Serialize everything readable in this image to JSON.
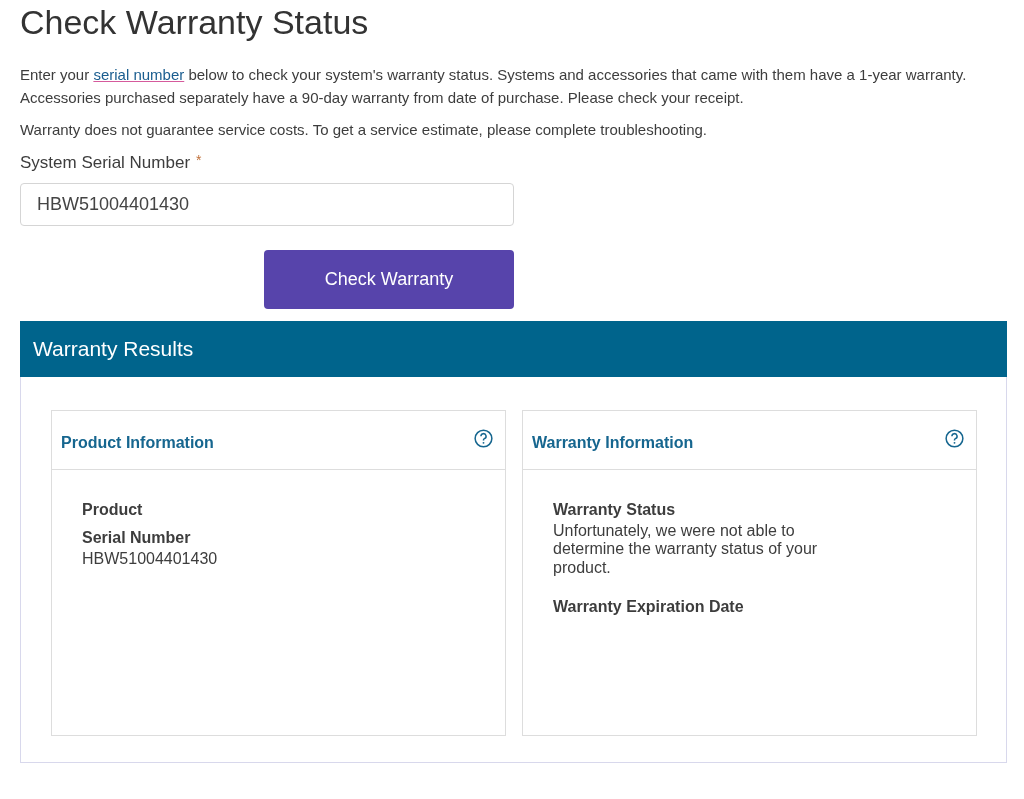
{
  "page_title": "Check Warranty Status",
  "intro": {
    "before": "Enter your ",
    "link": "serial number",
    "after": " below to check your system's warranty status. Systems and accessories that came with them have a 1-year warranty. Accessories purchased separately have a 90-day warranty from date of purchase. Please check your receipt."
  },
  "note": "Warranty does not guarantee service costs. To get a service estimate, please complete troubleshooting.",
  "serial_field": {
    "label": "System Serial Number",
    "required_mark": "*",
    "value": "HBW51004401430"
  },
  "submit_button": "Check Warranty",
  "results": {
    "title": "Warranty Results",
    "panels": [
      {
        "title": "Product Information",
        "fields": [
          {
            "label": "Product"
          },
          {
            "label": "Serial Number",
            "value": "HBW51004401430"
          }
        ]
      },
      {
        "title": "Warranty Information",
        "fields": [
          {
            "label": "Warranty Status",
            "value": "Unfortunately, we were not able to determine the warranty status of your product."
          },
          {
            "label": "Warranty Expiration Date"
          }
        ]
      }
    ]
  }
}
